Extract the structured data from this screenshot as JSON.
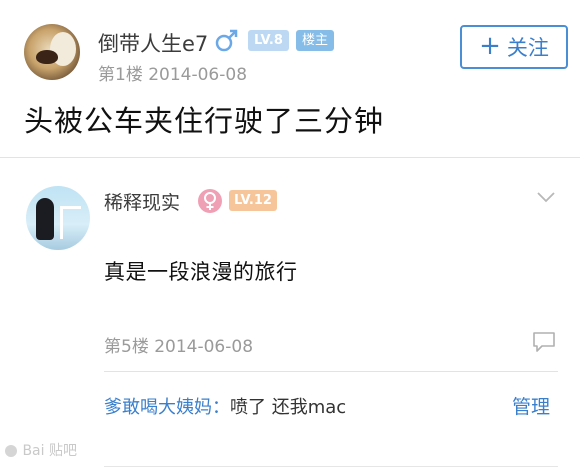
{
  "post1": {
    "username": "倒带人生e7",
    "gender_icon": "male-icon",
    "level_badge": "LV.8",
    "role_badge": "楼主",
    "floor_date": "第1楼  2014-06-08",
    "follow_plus": "+",
    "follow_label": "关注",
    "content": "头被公车夹住行驶了三分钟"
  },
  "post2": {
    "username": "稀释现实",
    "gender_icon": "female-icon",
    "level_badge": "LV.12",
    "content": "真是一段浪漫的旅行",
    "floor_date": "第5楼  2014-06-08",
    "reply": {
      "user": "爹敢喝大姨妈",
      "separator": "：",
      "text": "喷了 还我mac"
    },
    "manage_label": "管理"
  },
  "watermark": {
    "text": "Bai 贴吧"
  },
  "colors": {
    "accent_blue": "#3a7fcc",
    "male_blue": "#6aa8e8",
    "female_pink": "#f0a0b4",
    "level_orange": "#f6c69a",
    "level_blue": "#bcd8f2"
  }
}
